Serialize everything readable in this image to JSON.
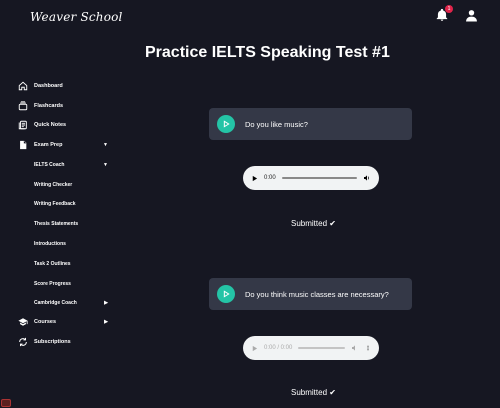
{
  "brand": {
    "name": "Weaver School"
  },
  "header": {
    "notification_count": "1"
  },
  "sidebar": {
    "items": [
      {
        "label": "Dashboard",
        "icon": "home-icon"
      },
      {
        "label": "Flashcards",
        "icon": "cards-icon"
      },
      {
        "label": "Quick Notes",
        "icon": "notes-icon"
      },
      {
        "label": "Exam Prep",
        "icon": "document-icon",
        "caret": "▼"
      },
      {
        "label": "Courses",
        "icon": "graduation-cap-icon",
        "caret": "▶"
      },
      {
        "label": "Subscriptions",
        "icon": "refresh-icon"
      }
    ],
    "subitems": [
      {
        "label": "IELTS Coach",
        "caret": "▼"
      },
      {
        "label": "Writing Checker"
      },
      {
        "label": "Writing Feedback"
      },
      {
        "label": "Thesis Statements"
      },
      {
        "label": "Introductions"
      },
      {
        "label": "Task 2 Outlines"
      },
      {
        "label": "Score Progress"
      },
      {
        "label": "Cambridge Coach",
        "caret": "▶"
      }
    ]
  },
  "main": {
    "title": "Practice IELTS Speaking Test #1",
    "questions": [
      {
        "text": "Do you like music?",
        "audio_time": "0:00",
        "status": "Submitted ✔"
      },
      {
        "text": "Do you think music classes are necessary?",
        "audio_time": "0:00 / 0:00",
        "status": "Submitted ✔"
      }
    ]
  },
  "colors": {
    "background": "#161722",
    "card": "#343847",
    "accent": "#24c4a6",
    "badge": "#e0244a"
  }
}
